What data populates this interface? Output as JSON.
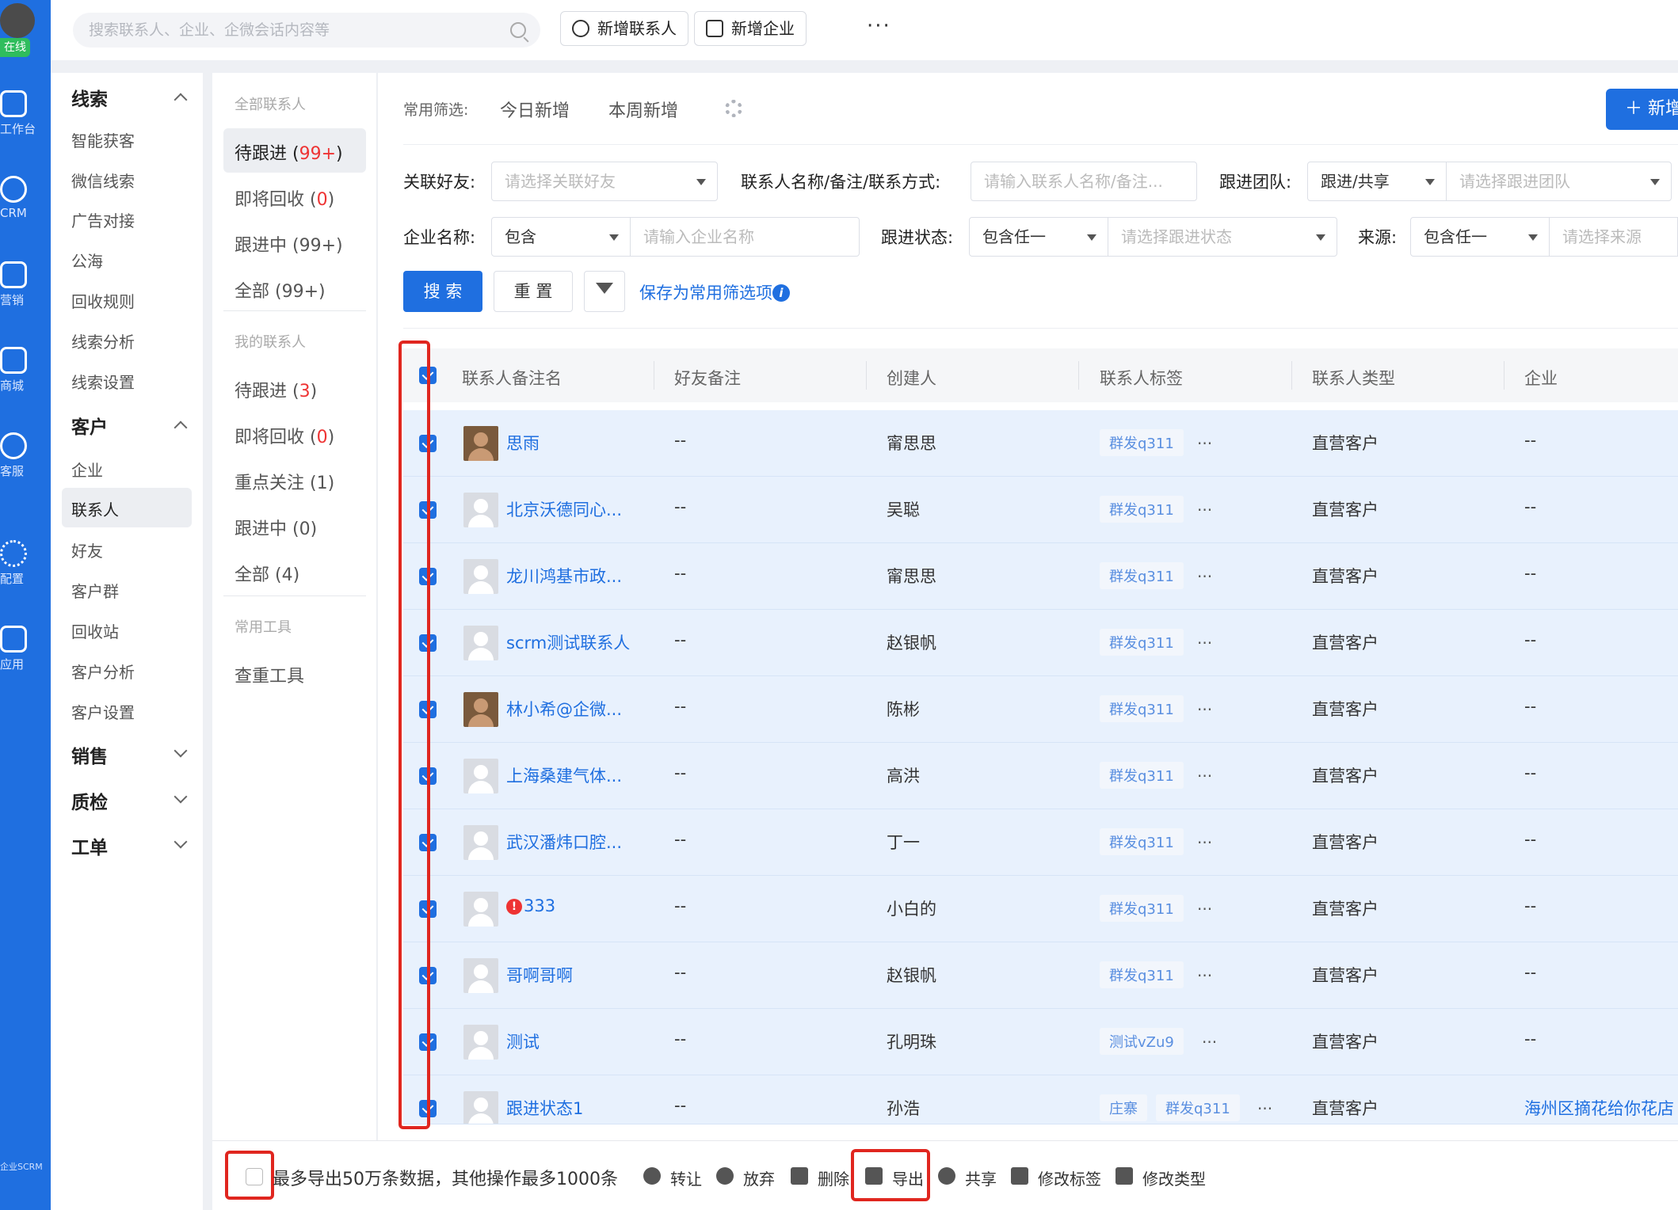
{
  "rail": {
    "status": "在线",
    "items": [
      {
        "label": "工作台",
        "icon": "monitor-icon"
      },
      {
        "label": "CRM",
        "icon": "person-icon"
      },
      {
        "label": "营销",
        "icon": "chart-icon"
      },
      {
        "label": "商城",
        "icon": "shop-icon"
      },
      {
        "label": "客服",
        "icon": "phone-icon"
      },
      {
        "label": "配置",
        "icon": "gear-icon"
      },
      {
        "label": "应用",
        "icon": "apps-icon"
      }
    ],
    "brand": "企业SCRM"
  },
  "topbar": {
    "search_placeholder": "搜索联系人、企业、企微会话内容等",
    "add_contact": "新增联系人",
    "add_company": "新增企业",
    "more": "···"
  },
  "nav2": {
    "groups": [
      {
        "title": "线索",
        "items": [
          "智能获客",
          "微信线索",
          "广告对接",
          "公海",
          "回收规则",
          "线索分析",
          "线索设置"
        ]
      },
      {
        "title": "客户",
        "items": [
          "企业",
          "联系人",
          "好友",
          "客户群",
          "回收站",
          "客户分析",
          "客户设置"
        ]
      },
      {
        "title": "销售"
      },
      {
        "title": "质检"
      },
      {
        "title": "工单"
      }
    ]
  },
  "col3": {
    "all_header": "全部联系人",
    "all_items": [
      {
        "label": "待跟进",
        "count": "99+"
      },
      {
        "label": "即将回收",
        "count": "0"
      },
      {
        "label": "跟进中 (99+)"
      },
      {
        "label": "全部 (99+)"
      }
    ],
    "mine_header": "我的联系人",
    "mine_items": [
      {
        "label": "待跟进",
        "count": "3"
      },
      {
        "label": "即将回收",
        "count": "0"
      },
      {
        "label": "重点关注 (1)"
      },
      {
        "label": "跟进中 (0)"
      },
      {
        "label": "全部 (4)"
      }
    ],
    "tools_header": "常用工具",
    "tools_items": [
      "查重工具"
    ]
  },
  "filters": {
    "quick_label": "常用筛选:",
    "quick": [
      "今日新增",
      "本周新增"
    ],
    "add_button": "＋ 新增",
    "friend_label": "关联好友:",
    "friend_placeholder": "请选择关联好友",
    "name_label": "联系人名称/备注/联系方式:",
    "name_placeholder": "请输入联系人名称/备注...",
    "team_label": "跟进团队:",
    "team_mode": "跟进/共享",
    "team_placeholder": "请选择跟进团队",
    "company_label": "企业名称:",
    "company_mode": "包含",
    "company_placeholder": "请输入企业名称",
    "status_label": "跟进状态:",
    "status_mode": "包含任一",
    "status_placeholder": "请选择跟进状态",
    "source_label": "来源:",
    "source_mode": "包含任一",
    "source_placeholder": "请选择来源",
    "search_button": "搜 索",
    "reset_button": "重 置",
    "save_link": "保存为常用筛选项"
  },
  "table": {
    "columns": [
      "联系人备注名",
      "好友备注",
      "创建人",
      "联系人标签",
      "联系人类型",
      "企业"
    ],
    "rows": [
      {
        "name": "思雨",
        "friend_note": "--",
        "creator": "甯思思",
        "tags": [
          "群发q311"
        ],
        "type": "直营客户",
        "company": "--",
        "avatar": "photo"
      },
      {
        "name": "北京沃德同心...",
        "friend_note": "--",
        "creator": "吴聪",
        "tags": [
          "群发q311"
        ],
        "type": "直营客户",
        "company": "--",
        "avatar": "default"
      },
      {
        "name": "龙川鸿基市政...",
        "friend_note": "--",
        "creator": "甯思思",
        "tags": [
          "群发q311"
        ],
        "type": "直营客户",
        "company": "--",
        "avatar": "default"
      },
      {
        "name": "scrm测试联系人",
        "friend_note": "--",
        "creator": "赵银帆",
        "tags": [
          "群发q311"
        ],
        "type": "直营客户",
        "company": "--",
        "avatar": "default"
      },
      {
        "name": "林小希@企微...",
        "friend_note": "--",
        "creator": "陈彬",
        "tags": [
          "群发q311"
        ],
        "type": "直营客户",
        "company": "--",
        "avatar": "photo"
      },
      {
        "name": "上海桑建气体...",
        "friend_note": "--",
        "creator": "高洪",
        "tags": [
          "群发q311"
        ],
        "type": "直营客户",
        "company": "--",
        "avatar": "default"
      },
      {
        "name": "武汉潘炜口腔...",
        "friend_note": "--",
        "creator": "丁一",
        "tags": [
          "群发q311"
        ],
        "type": "直营客户",
        "company": "--",
        "avatar": "default"
      },
      {
        "name": "333",
        "friend_note": "--",
        "creator": "小白的",
        "tags": [
          "群发q311"
        ],
        "type": "直营客户",
        "company": "--",
        "avatar": "default",
        "warn": true
      },
      {
        "name": "哥啊哥啊",
        "friend_note": "--",
        "creator": "赵银帆",
        "tags": [
          "群发q311"
        ],
        "type": "直营客户",
        "company": "--",
        "avatar": "default"
      },
      {
        "name": "测试",
        "friend_note": "--",
        "creator": "孔明珠",
        "tags": [
          "测试vZu9"
        ],
        "type": "直营客户",
        "company": "--",
        "avatar": "default"
      },
      {
        "name": "跟进状态1",
        "friend_note": "--",
        "creator": "孙浩",
        "tags": [
          "庄寨",
          "群发q311"
        ],
        "type": "直营客户",
        "company": "海州区摘花给你花店",
        "avatar": "default"
      }
    ]
  },
  "footer": {
    "note": "最多导出50万条数据，其他操作最多1000条",
    "actions": [
      {
        "label": "转让",
        "icon": "transfer-icon"
      },
      {
        "label": "放弃",
        "icon": "abandon-icon"
      },
      {
        "label": "删除",
        "icon": "trash-icon"
      },
      {
        "label": "导出",
        "icon": "export-icon"
      },
      {
        "label": "共享",
        "icon": "share-icon"
      },
      {
        "label": "修改标签",
        "icon": "pencil-icon"
      },
      {
        "label": "修改类型",
        "icon": "pencil-icon"
      }
    ]
  },
  "colors": {
    "primary": "#1f6fe0",
    "highlight": "#e0261f",
    "row_selected": "#e8f1fd",
    "online": "#2fbd5d"
  }
}
